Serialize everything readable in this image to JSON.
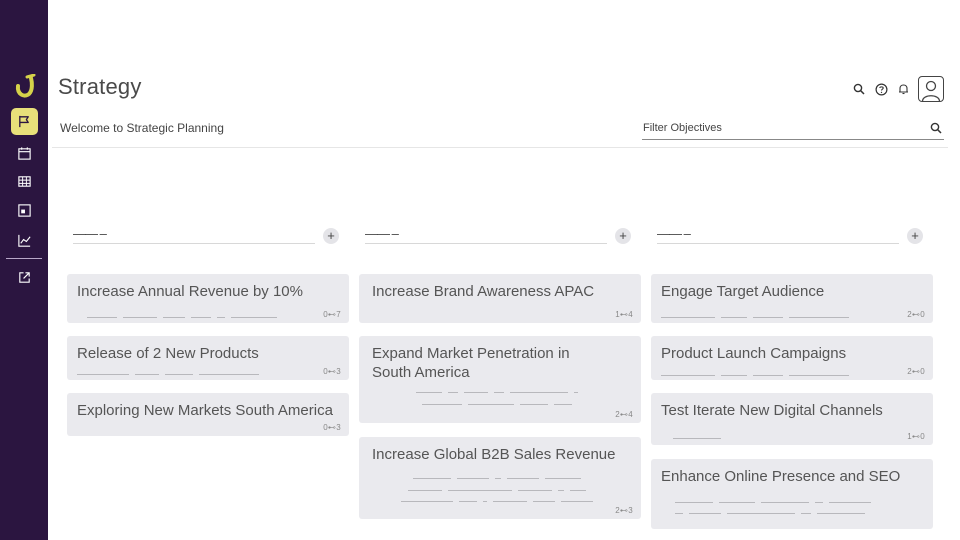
{
  "app": {
    "title": "Strategy"
  },
  "header": {
    "welcome": "Welcome to Strategic Planning",
    "filter_placeholder": "Filter Objectives"
  },
  "sidebar": {
    "items": [
      {
        "icon": "flag-icon",
        "active": true
      },
      {
        "icon": "calendar-icon",
        "active": false
      },
      {
        "icon": "table-icon",
        "active": false
      },
      {
        "icon": "board-icon",
        "active": false
      },
      {
        "icon": "chart-icon",
        "active": false
      },
      {
        "icon": "external-link-icon",
        "active": false
      }
    ]
  },
  "colors": {
    "sidebar": "#2b1540",
    "active": "#e8e07a",
    "card": "#eaeaee"
  },
  "columns": [
    {
      "header": "—— –",
      "cards": [
        {
          "title": "Increase Annual Revenue by 10%",
          "meta": "0⊷7"
        },
        {
          "title": "Release of 2 New Products",
          "meta": "0⊷3"
        },
        {
          "title": "Exploring New Markets South America",
          "meta": "0⊷3"
        }
      ]
    },
    {
      "header": "—— –",
      "cards": [
        {
          "title": "Increase Brand Awareness APAC",
          "meta": "1⊷4"
        },
        {
          "title": "Expand Market Penetration in South America",
          "meta": "2⊷4"
        },
        {
          "title": "Increase Global B2B Sales Revenue",
          "meta": "2⊷3"
        }
      ]
    },
    {
      "header": "—— –",
      "cards": [
        {
          "title": "Engage Target Audience",
          "meta": "2⊷0"
        },
        {
          "title": "Product Launch Campaigns",
          "meta": "2⊷0"
        },
        {
          "title": "Test Iterate New Digital Channels",
          "meta": "1⊷0"
        },
        {
          "title": "Enhance Online Presence and SEO",
          "meta": ""
        }
      ]
    }
  ]
}
